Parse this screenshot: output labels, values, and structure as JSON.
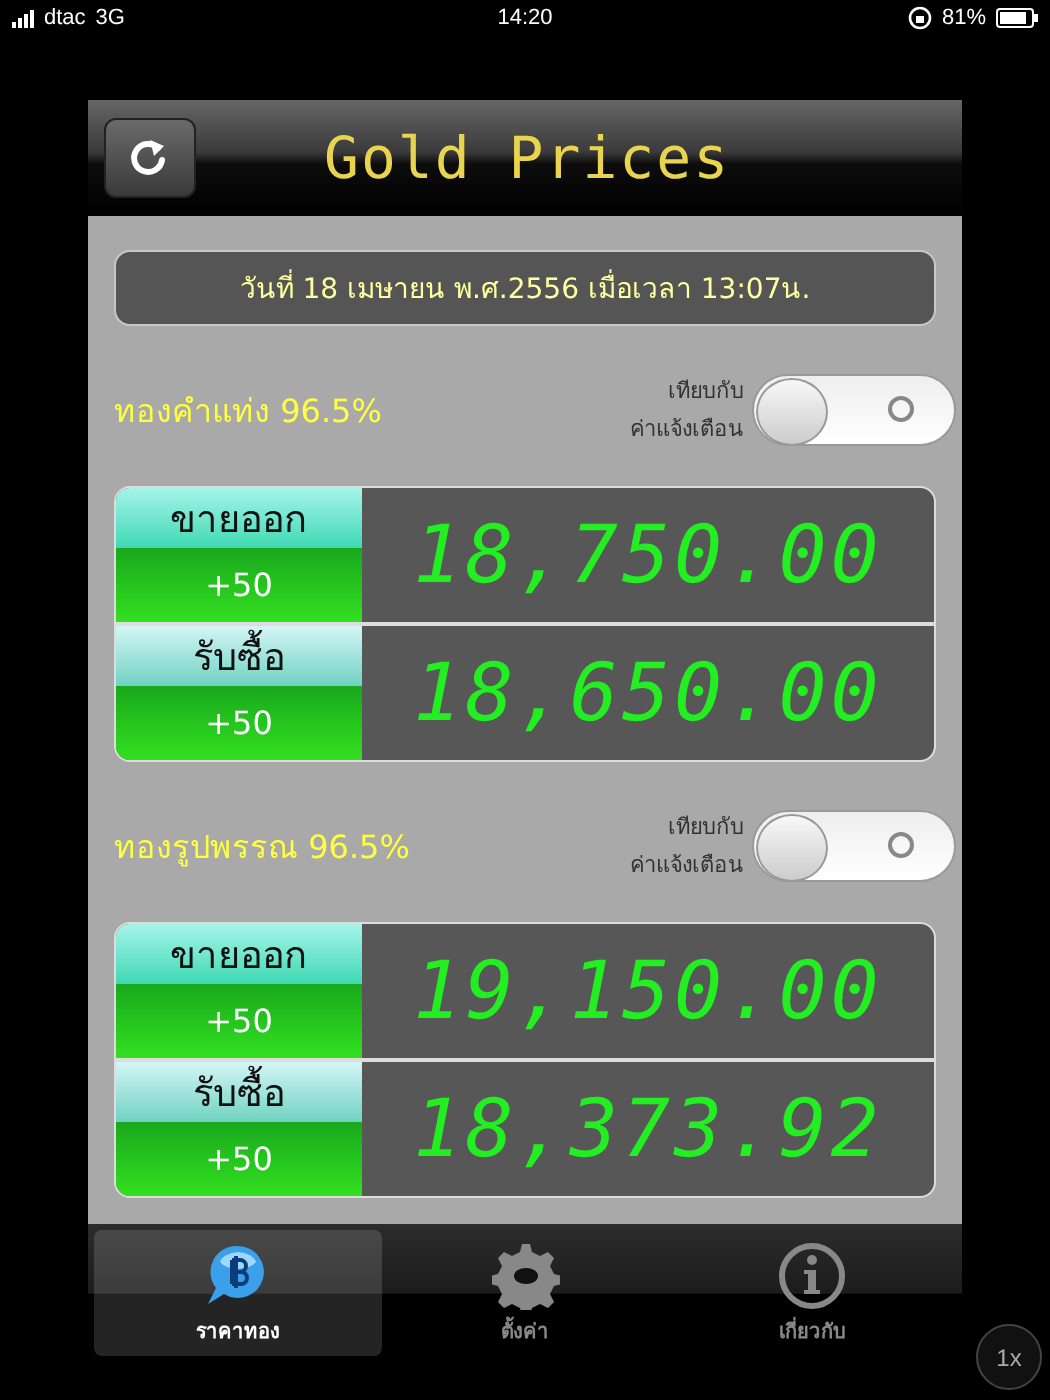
{
  "status_bar": {
    "carrier": "dtac",
    "network": "3G",
    "time": "14:20",
    "battery": "81%"
  },
  "header": {
    "title": "Gold Prices"
  },
  "date_line": "วันที่ 18 เมษายน พ.ศ.2556 เมื่อเวลา 13:07น.",
  "sections": [
    {
      "title": "ทองคำแท่ง 96.5%",
      "compare_label": [
        "เทียบกับ",
        "ค่าแจ้งเตือน"
      ],
      "toggle_on": false,
      "rows": [
        {
          "kind": "sell",
          "label": "ขายออก",
          "change": "+50",
          "price": "18,750.00"
        },
        {
          "kind": "buy",
          "label": "รับซื้อ",
          "change": "+50",
          "price": "18,650.00"
        }
      ]
    },
    {
      "title": "ทองรูปพรรณ 96.5%",
      "compare_label": [
        "เทียบกับ",
        "ค่าแจ้งเตือน"
      ],
      "toggle_on": false,
      "rows": [
        {
          "kind": "sell",
          "label": "ขายออก",
          "change": "+50",
          "price": "19,150.00"
        },
        {
          "kind": "buy",
          "label": "รับซื้อ",
          "change": "+50",
          "price": "18,373.92"
        }
      ]
    }
  ],
  "tabs": [
    {
      "kind": "price",
      "label": "ราคาทอง",
      "selected": true
    },
    {
      "kind": "settings",
      "label": "ตั้งค่า",
      "selected": false
    },
    {
      "kind": "about",
      "label": "เกี่ยวกับ",
      "selected": false
    }
  ],
  "zoom_button": "1x"
}
